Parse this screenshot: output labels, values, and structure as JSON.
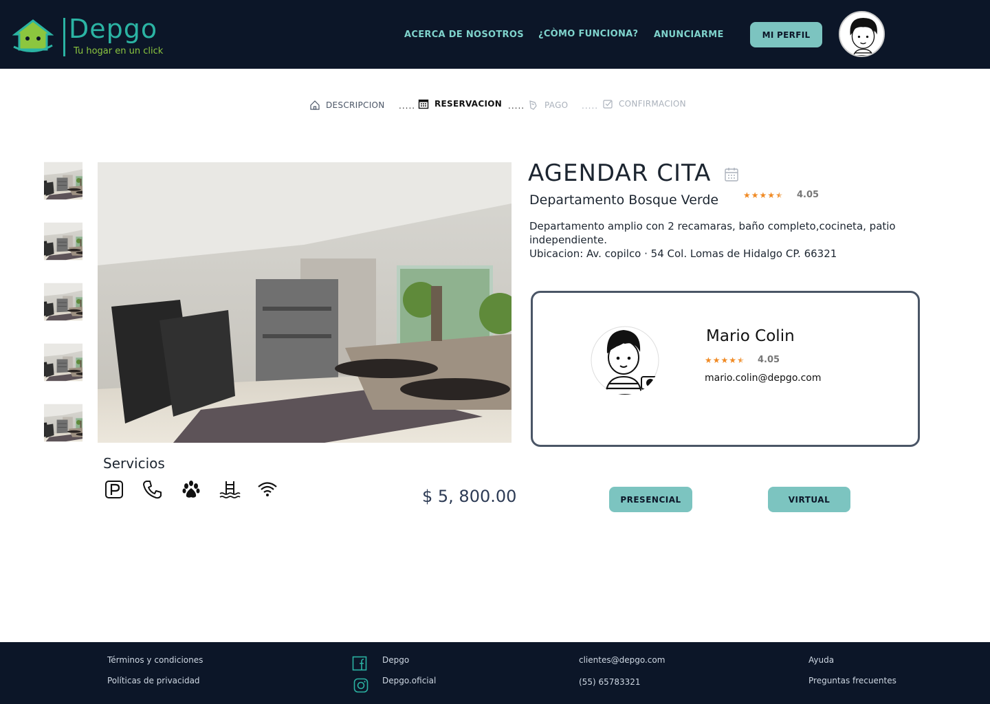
{
  "brand": {
    "name": "Depgo",
    "tagline": "Tu hogar en un click",
    "accent": "#2bb3a3",
    "tagline_color": "#8cc63f",
    "dark": "#0c1628",
    "button_color": "#7cc4c0"
  },
  "nav": {
    "about": "ACERCA DE NOSOTROS",
    "how": "¿CÒMO FUNCIONA?",
    "advertise": "ANUNCIARME",
    "profile": "MI PERFIL"
  },
  "steps": [
    {
      "label": "DESCRIPCION",
      "icon": "home-icon",
      "state": "done"
    },
    {
      "label": "RESERVACION",
      "icon": "calendar-icon",
      "state": "active"
    },
    {
      "label": "PAGO",
      "icon": "payment-icon",
      "state": "pending"
    },
    {
      "label": "CONFIRMACION",
      "icon": "confirm-icon",
      "state": "pending"
    }
  ],
  "step_separator": ".....",
  "listing": {
    "heading": "AGENDAR CITA",
    "title": "Departamento Bosque Verde",
    "rating": "4.05",
    "rating_value": 4.5,
    "description_line1": "Departamento amplio con 2 recamaras, baño completo,cocineta, patio independiente.",
    "description_line2": "Ubicacion: Av. copilco · 54 Col. Lomas de Hidalgo CP. 66321",
    "services_title": "Servicios",
    "services": [
      "parking-icon",
      "phone-icon",
      "paw-icon",
      "pool-icon",
      "wifi-icon"
    ],
    "price": "$ 5, 800.00"
  },
  "agent": {
    "name": "Mario Colin",
    "rating": "4.05",
    "email": "mario.colin@depgo.com"
  },
  "modes": {
    "in_person": "PRESENCIAL",
    "virtual": "VIRTUAL"
  },
  "footer": {
    "terms": "Términos y condiciones",
    "privacy": "Políticas  de privacidad",
    "facebook": "Depgo",
    "instagram": "Depgo.oficial",
    "email": "clientes@depgo.com",
    "phone": "(55) 65783321",
    "help": "Ayuda",
    "faq": "Preguntas frecuentes"
  }
}
